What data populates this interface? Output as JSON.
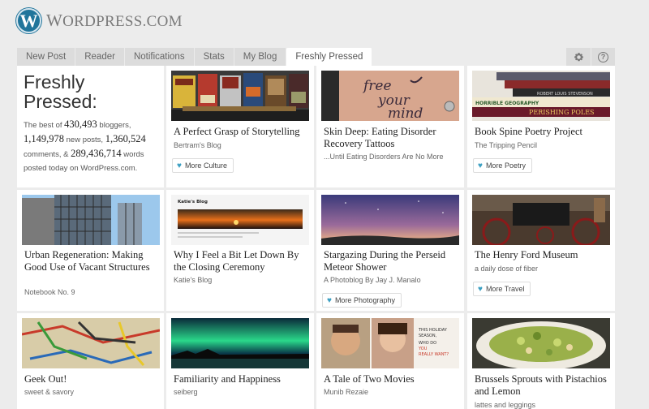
{
  "logo": {
    "mark": "W",
    "text_big_w": "W",
    "text_rest": "ORDPRESS.COM"
  },
  "tabs": [
    {
      "label": "New Post"
    },
    {
      "label": "Reader"
    },
    {
      "label": "Notifications"
    },
    {
      "label": "Stats"
    },
    {
      "label": "My Blog"
    },
    {
      "label": "Freshly Pressed"
    }
  ],
  "tab_icons": {
    "settings": "gear-icon",
    "help": "?"
  },
  "intro": {
    "title_line1": "Freshly",
    "title_line2": "Pressed:",
    "pre_bloggers": "The best of ",
    "bloggers": "430,493",
    "post_bloggers": " bloggers,",
    "posts": "1,149,978",
    "post_posts": " new posts, ",
    "comments": "1,360,524",
    "post_comments": " comments, & ",
    "words": "289,436,714",
    "post_words": " words posted today on WordPress.com."
  },
  "cards": [
    {
      "title": "A Perfect Grasp of Storytelling",
      "sub": "Bertram's Blog",
      "more": "More Culture"
    },
    {
      "title": "Skin Deep: Eating Disorder Recovery Tattoos",
      "sub": "...Until Eating Disorders Are No More",
      "more": "",
      "thumb_text": [
        "free",
        "your",
        "mind"
      ]
    },
    {
      "title": "Book Spine Poetry Project",
      "sub": "The Tripping Pencil",
      "more": "More Poetry",
      "thumb_text": [
        "ROBERT LOUIS STEVENSON",
        "HORRIBLE GEOGRAPHY",
        "PERISHING POLES"
      ]
    },
    {
      "title": "Urban Regeneration: Making Good Use of Vacant Structures",
      "sub": "Notebook No. 9",
      "more": ""
    },
    {
      "title": "Why I Feel a Bit Let Down By the Closing Ceremony",
      "sub": "Katie's Blog",
      "more": "",
      "thumb_text": [
        "Katie's Blog"
      ]
    },
    {
      "title": "Stargazing During the Perseid Meteor Shower",
      "sub": "A Photoblog By Jay J. Manalo",
      "more": "More Photography"
    },
    {
      "title": "The Henry Ford Museum",
      "sub": "a daily dose of fiber",
      "more": "More Travel"
    },
    {
      "title": "Geek Out!",
      "sub": "sweet & savory",
      "more": ""
    },
    {
      "title": "Familiarity and Happiness",
      "sub": "seiberg",
      "more": ""
    },
    {
      "title": "A Tale of Two Movies",
      "sub": "Munib Rezaie",
      "more": "",
      "thumb_text": [
        "THIS HOLIDAY",
        "SEASON,",
        "WHO DO",
        "YOU",
        "REALLY WANT?"
      ]
    },
    {
      "title": "Brussels Sprouts with Pistachios and Lemon",
      "sub": "lattes and leggings",
      "more": ""
    }
  ]
}
